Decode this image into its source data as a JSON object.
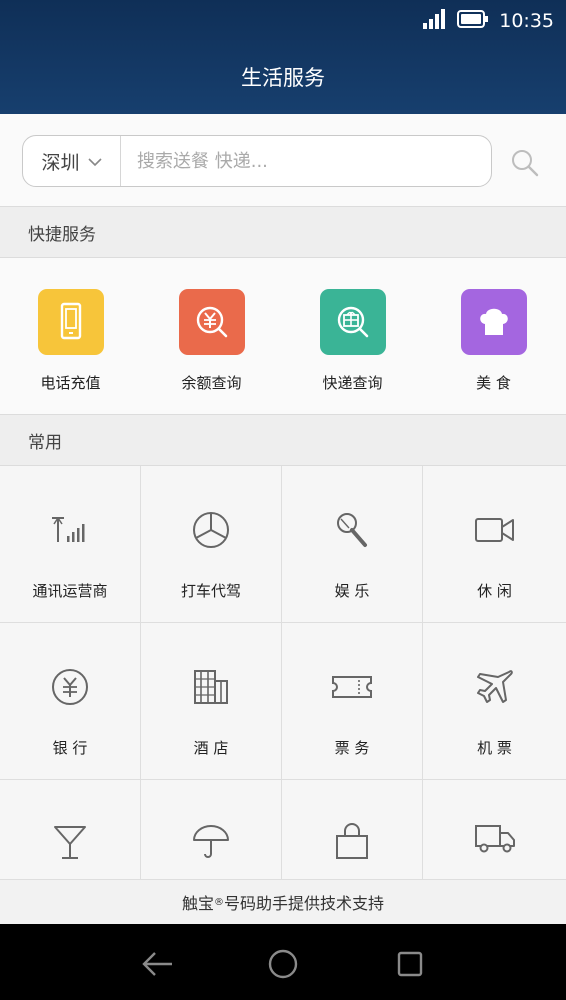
{
  "status_bar": {
    "time": "10:35",
    "signal_icon": "signal-icon",
    "battery_icon": "battery-icon"
  },
  "header": {
    "title": "生活服务"
  },
  "search": {
    "city": "深圳",
    "placeholder": "搜索送餐 快递..."
  },
  "quick_services": {
    "title": "快捷服务",
    "items": [
      {
        "label": "电话充值",
        "icon": "phone-icon",
        "color": "#f7c53a"
      },
      {
        "label": "余额查询",
        "icon": "yuan-search-icon",
        "color": "#ea6a4b"
      },
      {
        "label": "快递查询",
        "icon": "package-search-icon",
        "color": "#3ab496"
      },
      {
        "label": "美 食",
        "icon": "chef-hat-icon",
        "color": "#a466e0"
      }
    ]
  },
  "common": {
    "title": "常用",
    "items": [
      {
        "label": "通讯运营商",
        "icon": "signal-tower-icon"
      },
      {
        "label": "打车代驾",
        "icon": "steering-wheel-icon"
      },
      {
        "label": "娱 乐",
        "icon": "microphone-icon"
      },
      {
        "label": "休 闲",
        "icon": "video-camera-icon"
      },
      {
        "label": "银 行",
        "icon": "yuan-coin-icon"
      },
      {
        "label": "酒 店",
        "icon": "building-icon"
      },
      {
        "label": "票 务",
        "icon": "ticket-icon"
      },
      {
        "label": "机 票",
        "icon": "airplane-icon"
      },
      {
        "label": "",
        "icon": "wine-glass-icon"
      },
      {
        "label": "",
        "icon": "umbrella-icon"
      },
      {
        "label": "",
        "icon": "shopping-bag-icon"
      },
      {
        "label": "",
        "icon": "truck-icon"
      }
    ]
  },
  "footer": {
    "prefix": "触宝",
    "mark": "®",
    "suffix": "号码助手提供技术支持"
  },
  "nav_bar": {
    "back_icon": "back-icon",
    "home_icon": "home-icon",
    "recent_icon": "recent-apps-icon"
  }
}
